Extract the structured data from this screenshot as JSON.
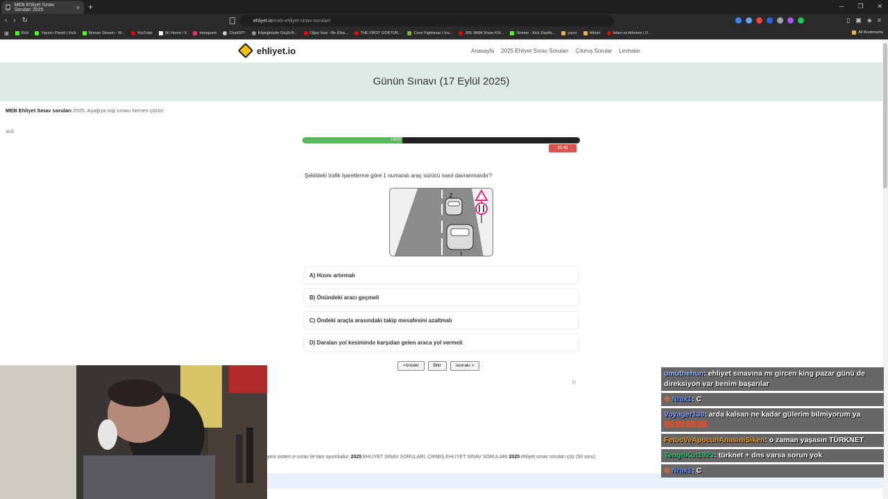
{
  "browser": {
    "tab_title": "MEB Ehliyet Sınav Soruları 2025",
    "tab_close": "×",
    "new_tab": "+",
    "url_domain": "ehliyet.io",
    "url_path": "/meb-ehliyet-sinav-sorulari/",
    "bookmarks": [
      "Kick",
      "Yayıncı Paneli | Kick",
      "İkinsan Stream - W...",
      "YouTube",
      "(4) Home / X",
      "Instagram",
      "ChatGPT",
      "Köpeğinizde Güçlü B...",
      "Oğuz Sasi - Bir Efsa...",
      "THE FIRST GOKTUR...",
      "Cave Fightwear | Ins...",
      "JRE MMA Show #16...",
      "Stream - Kick Dashb...",
      "yayın",
      "Albüm",
      "İslam vs Atheism | O..."
    ],
    "all_bookmarks": "All Bookmarks"
  },
  "site": {
    "logo_text": "ehliyet.io",
    "menu": [
      "Anasayfa",
      "2025 Ehliyet Sınav Soruları",
      "Çıkmış Sorular",
      "Levhalar"
    ]
  },
  "hero": {
    "title": "Günün Sınavı (17 Eylül 2025)"
  },
  "intro": {
    "bold": "MEB Ehliyet Sınav soruları",
    "rest": " 2025. Aşağıya inip sınavı hemen çözün"
  },
  "xx3": "xx3",
  "quiz": {
    "progress_fraction": 0.36,
    "progress_label": "18/50",
    "timer": "35:49",
    "question": "Şekildeki trafik işaretlerine göre 1 numaralı araç sürücü nasıl davranmalıdır?",
    "image_labels": {
      "car_top": "2",
      "car_bottom": "1"
    },
    "options": [
      "A) Hızını artırmalı",
      "B) Önündeki aracı geçmeli",
      "C) Öndeki araçla arasındaki takip mesafesini azaltmalı",
      "D) Daralan yol kesiminde karşıdan gelen araca yol vermeli"
    ],
    "prev": "<önceki",
    "finish": "Bitir",
    "next": "sonraki >"
  },
  "footer": {
    "text_1": "yeni sistem e-sınav ile tam uyumludur. ",
    "bold_1": "2025",
    "text_2": " EHLİYET SINAV SORULARI, ÇIKMIŞ EHLİYET SINAV SORULARI ",
    "bold_2": "2025",
    "text_3": " ehliyet sınav soruları çöz (50 soru)"
  },
  "chat": [
    {
      "user": "umuthehun",
      "text": "ehliyet sınavına mı gircen king pazar günü de direksiyon var benim başarılar"
    },
    {
      "user": "Nrax1",
      "text": "C"
    },
    {
      "user": "Voyager138",
      "text": "arda kalsan ne kadar gülerim bilmiyorum ya"
    },
    {
      "user": "FetocVeApocunAnasiniSiken",
      "text": "o zaman yaşasın TÜRKNET"
    },
    {
      "user": "TengriKut1923",
      "text": "türknet + dns varsa sorun yok"
    },
    {
      "user": "Nrax1",
      "text": "C"
    }
  ],
  "colors": {
    "progress": "#5cb85c",
    "timer": "#d9534f",
    "hero_bg": "#dfe9e8"
  }
}
